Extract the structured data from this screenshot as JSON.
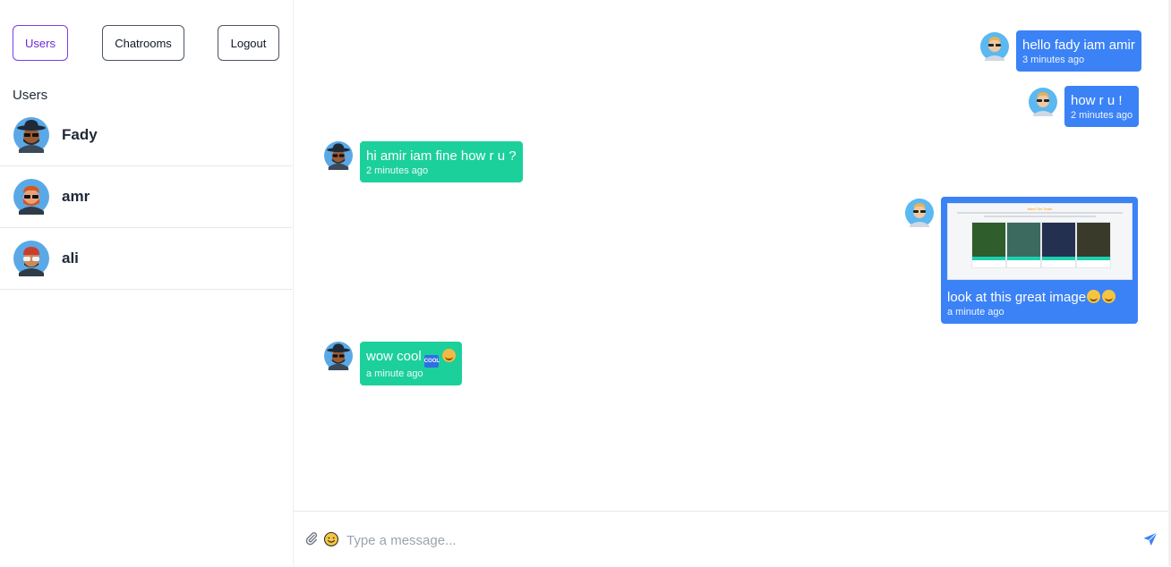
{
  "nav": {
    "users_label": "Users",
    "chatrooms_label": "Chatrooms",
    "logout_label": "Logout"
  },
  "sidebar": {
    "section_title": "Users",
    "users": [
      {
        "name": "Fady",
        "avatar": "hat-sunglasses-man-icon"
      },
      {
        "name": "amr",
        "avatar": "red-hair-sunglasses-man-icon"
      },
      {
        "name": "ali",
        "avatar": "red-cap-sunglasses-man-icon"
      }
    ]
  },
  "messages": [
    {
      "side": "sent",
      "text": "hello fady iam amir",
      "time": "3 minutes ago"
    },
    {
      "side": "sent",
      "text": "how r u !",
      "time": "2 minutes ago"
    },
    {
      "side": "received",
      "text": "hi amir iam fine how r u ?",
      "time": "2 minutes ago"
    },
    {
      "side": "sent",
      "text": "look at this great image",
      "time": "a minute ago",
      "has_image": true,
      "image_title": "Meet The Team"
    },
    {
      "side": "received",
      "text": "wow cool",
      "time": "a minute ago"
    }
  ],
  "composer": {
    "placeholder": "Type a message..."
  },
  "colors": {
    "sent_bubble": "#3b82f6",
    "received_bubble": "#1cd09b",
    "active_tab": "#7c3aed",
    "send_icon": "#3b82f6"
  }
}
